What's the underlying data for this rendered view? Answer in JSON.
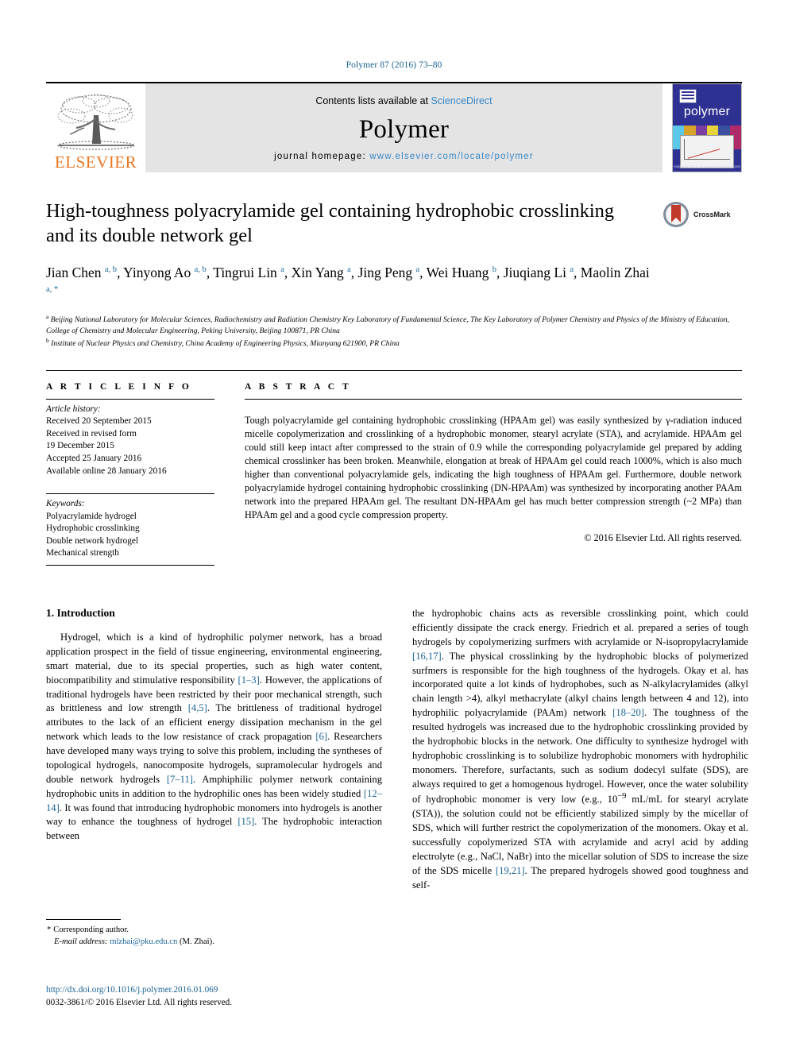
{
  "running_head": "Polymer 87 (2016) 73–80",
  "masthead": {
    "publisher_name": "ELSEVIER",
    "contents_prefix": "Contents lists available at ",
    "contents_link": "ScienceDirect",
    "journal_name": "Polymer",
    "homepage_prefix": "journal homepage: ",
    "homepage_url": "www.elsevier.com/locate/polymer",
    "cover_title": "polymer",
    "cover_footer": "Available online at www.sciencedirect.com"
  },
  "crossmark": {
    "label": "CrossMark"
  },
  "article": {
    "title": "High-toughness polyacrylamide gel containing hydrophobic crosslinking and its double network gel",
    "authors": [
      {
        "name": "Jian Chen",
        "marks": "a, b",
        "sep": ", "
      },
      {
        "name": "Yinyong Ao",
        "marks": "a, b",
        "sep": ", "
      },
      {
        "name": "Tingrui Lin",
        "marks": "a",
        "sep": ", "
      },
      {
        "name": "Xin Yang",
        "marks": "a",
        "sep": ", "
      },
      {
        "name": "Jing Peng",
        "marks": "a",
        "sep": ", "
      },
      {
        "name": "Wei Huang",
        "marks": "b",
        "sep": ", "
      },
      {
        "name": "Jiuqiang Li",
        "marks": "a",
        "sep": ", "
      },
      {
        "name": "Maolin Zhai",
        "marks": "a, *",
        "sep": ""
      }
    ],
    "affiliation_a_mark": "a",
    "affiliation_a": "Beijing National Laboratory for Molecular Sciences, Radiochemistry and Radiation Chemistry Key Laboratory of Fundamental Science, The Key Laboratory of Polymer Chemistry and Physics of the Ministry of Education, College of Chemistry and Molecular Engineering, Peking University, Beijing 100871, PR China",
    "affiliation_b_mark": "b",
    "affiliation_b": "Institute of Nuclear Physics and Chemistry, China Academy of Engineering Physics, Mianyang 621900, PR China"
  },
  "article_info": {
    "heading": "A R T I C L E   I N F O",
    "history_label": "Article history:",
    "history": [
      "Received 20 September 2015",
      "Received in revised form",
      "19 December 2015",
      "Accepted 25 January 2016",
      "Available online 28 January 2016"
    ],
    "keywords_label": "Keywords:",
    "keywords": [
      "Polyacrylamide hydrogel",
      "Hydrophobic crosslinking",
      "Double network hydrogel",
      "Mechanical strength"
    ]
  },
  "abstract": {
    "heading": "A B S T R A C T",
    "text": "Tough polyacrylamide gel containing hydrophobic crosslinking (HPAAm gel) was easily synthesized by γ-radiation induced micelle copolymerization and crosslinking of a hydrophobic monomer, stearyl acrylate (STA), and acrylamide. HPAAm gel could still keep intact after compressed to the strain of 0.9 while the corresponding polyacrylamide gel prepared by adding chemical crosslinker has been broken. Meanwhile, elongation at break of HPAAm gel could reach 1000%, which is also much higher than conventional polyacrylamide gels, indicating the high toughness of HPAAm gel. Furthermore, double network polyacrylamide hydrogel containing hydrophobic crosslinking (DN-HPAAm) was synthesized by incorporating another PAAm network into the prepared HPAAm gel. The resultant DN-HPAAm gel has much better compression strength (~2 MPa) than HPAAm gel and a good cycle compression property.",
    "copyright": "© 2016 Elsevier Ltd. All rights reserved."
  },
  "introduction": {
    "heading": "1.  Introduction",
    "left_column_parts": [
      {
        "t": "text",
        "v": "Hydrogel, which is a kind of hydrophilic polymer network, has a broad application prospect in the field of tissue engineering, environmental engineering, smart material, due to its special properties, such as high water content, biocompatibility and stimulative responsibility "
      },
      {
        "t": "ref",
        "v": "[1–3]"
      },
      {
        "t": "text",
        "v": ". However, the applications of traditional hydrogels have been restricted by their poor mechanical strength, such as brittleness and low strength "
      },
      {
        "t": "ref",
        "v": "[4,5]"
      },
      {
        "t": "text",
        "v": ". The brittleness of traditional hydrogel attributes to the lack of an efficient energy dissipation mechanism in the gel network which leads to the low resistance of crack propagation "
      },
      {
        "t": "ref",
        "v": "[6]"
      },
      {
        "t": "text",
        "v": ". Researchers have developed many ways trying to solve this problem, including the syntheses of topological hydrogels, nanocomposite hydrogels, supramolecular hydrogels and double network hydrogels "
      },
      {
        "t": "ref",
        "v": "[7–11]"
      },
      {
        "t": "text",
        "v": ". Amphiphilic polymer network containing hydrophobic units in addition to the hydrophilic ones has been widely studied "
      },
      {
        "t": "ref",
        "v": "[12–14]"
      },
      {
        "t": "text",
        "v": ". It was found that introducing hydrophobic monomers into hydrogels is another way to enhance the toughness of hydrogel "
      },
      {
        "t": "ref",
        "v": "[15]"
      },
      {
        "t": "text",
        "v": ". The hydrophobic interaction between"
      }
    ],
    "right_column_parts": [
      {
        "t": "text",
        "v": "the hydrophobic chains acts as reversible crosslinking point, which could efficiently dissipate the crack energy. Friedrich et al. prepared a series of tough hydrogels by copolymerizing surfmers with acrylamide or N-isopropylacrylamide "
      },
      {
        "t": "ref",
        "v": "[16,17]"
      },
      {
        "t": "text",
        "v": ". The physical crosslinking by the hydrophobic blocks of polymerized surfmers is responsible for the high toughness of the hydrogels. Okay et al. has incorporated quite a lot kinds of hydrophobes, such as N-alkylacrylamides (alkyl chain length >4), alkyl methacrylate (alkyl chains length between 4 and 12), into hydrophilic polyacrylamide (PAAm) network "
      },
      {
        "t": "ref",
        "v": "[18–20]"
      },
      {
        "t": "text",
        "v": ". The toughness of the resulted hydrogels was increased due to the hydrophobic crosslinking provided by the hydrophobic blocks in the network. One difficulty to synthesize hydrogel with hydrophobic crosslinking is to solubilize hydrophobic monomers with hydrophilic monomers. Therefore, surfactants, such as sodium dodecyl sulfate (SDS), are always required to get a homogenous hydrogel. However, once the water solubility of hydrophobic monomer is very low (e.g., 10"
      },
      {
        "t": "sup",
        "v": "−9"
      },
      {
        "t": "text",
        "v": " mL/mL for stearyl acrylate (STA)), the solution could not be efficiently stabilized simply by the micellar of SDS, which will further restrict the copolymerization of the monomers. Okay et al. successfully copolymerized STA with acrylamide and acryl acid by adding electrolyte (e.g., NaCl, NaBr) into the micellar solution of SDS to increase the size of the SDS micelle "
      },
      {
        "t": "ref",
        "v": "[19,21]"
      },
      {
        "t": "text",
        "v": ". The prepared hydrogels showed good toughness and self-"
      }
    ]
  },
  "footnotes": {
    "corresponding_star": "*",
    "corresponding": "Corresponding author.",
    "email_label": "E-mail address:",
    "email": "mlzhai@pku.edu.cn",
    "email_suffix": "(M. Zhai).",
    "doi": "http://dx.doi.org/10.1016/j.polymer.2016.01.069",
    "issn_line": "0032-3861/© 2016 Elsevier Ltd. All rights reserved."
  },
  "colors": {
    "link": "#1a6496",
    "sciencedirect": "#3a87c8",
    "elsevier_orange": "#E87722",
    "band_gray": "#e4e4e4",
    "cover_blue": "#2e3192",
    "crossmark_red": "#c1392b"
  }
}
